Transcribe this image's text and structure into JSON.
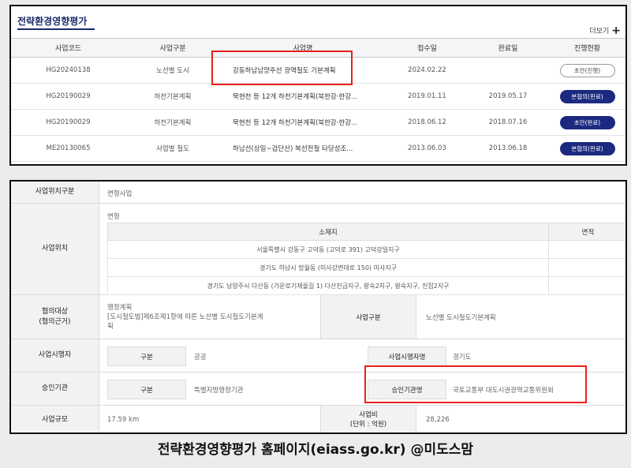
{
  "panel1": {
    "title": "전략환경영향평가",
    "more_label": "더보기",
    "more_icon": "+",
    "headers": [
      "사업코드",
      "사업구분",
      "사업명",
      "접수일",
      "완료일",
      "진행현황"
    ],
    "rows": [
      {
        "code": "HG20240138",
        "type": "노선별 도시",
        "name": "강동하남남양주선 광역철도 기본계획",
        "received": "2024.02.22",
        "completed": "",
        "status": "초안(진행)",
        "status_style": "outline"
      },
      {
        "code": "HG20190029",
        "type": "하천기본계획",
        "name": "묵현천 등 12개 하천기본계획(북한강·한강...",
        "received": "2019.01.11",
        "completed": "2019.05.17",
        "status": "본협의(완료)",
        "status_style": "fill"
      },
      {
        "code": "HG20190029",
        "type": "하천기본계획",
        "name": "묵현천 등 12개 하천기본계획(북한강·한강...",
        "received": "2018.06.12",
        "completed": "2018.07.16",
        "status": "초안(완료)",
        "status_style": "fill"
      },
      {
        "code": "ME20130065",
        "type": "사업별 철도",
        "name": "하남선(상일~검단산) 복선전철 타당성조...",
        "received": "2013.06.03",
        "completed": "2013.06.18",
        "status": "본협의(완료)",
        "status_style": "fill"
      }
    ]
  },
  "panel2": {
    "location_type_label": "사업위치구분",
    "location_type_value": "면형사업",
    "location_label": "사업위치",
    "location_sub": "면형",
    "location_headers": [
      "소재지",
      "면적"
    ],
    "locations": [
      "서울특별시 강동구 고덕동 (고덕로 391) 고덕강일지구",
      "경기도 하남시 망월동 (미사강변대로 150) 미사지구",
      "경기도 남양주시 다산동 (가운로기재울길 1) 다산진금지구, 왕숙2지구, 왕숙지구, 진접2지구"
    ],
    "consult_label_1": "협의대상",
    "consult_label_2": "(협의근거)",
    "consult_value_1": "행정계획",
    "consult_value_2": "[도시철도법]제6조제1항에 따른 노선별 도시철도기본계",
    "consult_value_3": "획",
    "biz_type_label": "사업구분",
    "biz_type_value": "노선별 도시철도기본계획",
    "executor_label": "사업시행자",
    "executor_sub_label": "구분",
    "executor_sub_value": "공공",
    "executor_name_label": "사업시행자명",
    "executor_name_value": "경기도",
    "approver_label": "승인기관",
    "approver_sub_label": "구분",
    "approver_sub_value": "특별지방행정기관",
    "approver_name_label": "승인기관명",
    "approver_name_value": "국토교통부 대도시권광역교통위원회",
    "scale_label": "사업규모",
    "scale_value": "17.59  km",
    "cost_label_1": "사업비",
    "cost_label_2": "(단위 : 억원)",
    "cost_value": "28,226"
  },
  "caption": "전략환경영향평가 홈페이지(eiass.go.kr)  @미도스맘",
  "colors": {
    "accent": "#1b2a80",
    "highlight": "#e8201a"
  }
}
